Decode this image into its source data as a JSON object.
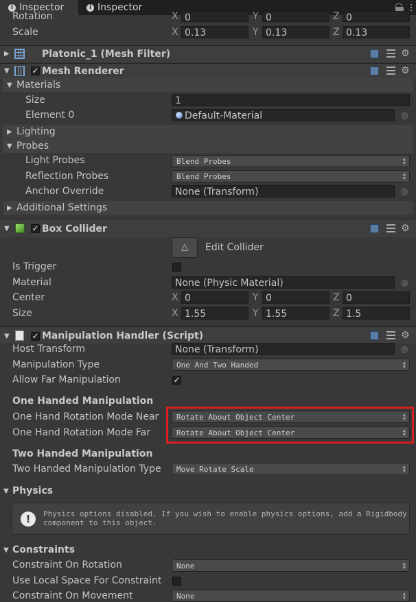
{
  "tabs": [
    {
      "label": "Inspector",
      "icon": "info-icon"
    },
    {
      "label": "Inspector",
      "icon": "info-icon"
    }
  ],
  "transform": {
    "rotation_label": "Rotation",
    "rotation": {
      "x": "0",
      "y": "0",
      "z": "0"
    },
    "scale_label": "Scale",
    "scale": {
      "x": "0.13",
      "y": "0.13",
      "z": "0.13"
    },
    "axis_labels": {
      "x": "X",
      "y": "Y",
      "z": "Z"
    }
  },
  "mesh_filter": {
    "title": "Platonic_1 (Mesh Filter)"
  },
  "mesh_renderer": {
    "title": "Mesh Renderer",
    "enabled": true,
    "materials_label": "Materials",
    "size_label": "Size",
    "size_value": "1",
    "element0_label": "Element 0",
    "element0_value": "Default-Material",
    "lighting_label": "Lighting",
    "probes_label": "Probes",
    "light_probes_label": "Light Probes",
    "light_probes_value": "Blend Probes",
    "reflection_probes_label": "Reflection Probes",
    "reflection_probes_value": "Blend Probes",
    "anchor_override_label": "Anchor Override",
    "anchor_override_value": "None (Transform)",
    "additional_settings_label": "Additional Settings"
  },
  "box_collider": {
    "title": "Box Collider",
    "enabled": true,
    "edit_collider_label": "Edit Collider",
    "is_trigger_label": "Is Trigger",
    "is_trigger": false,
    "material_label": "Material",
    "material_value": "None (Physic Material)",
    "center_label": "Center",
    "center": {
      "x": "0",
      "y": "0",
      "z": "0"
    },
    "size_label": "Size",
    "size": {
      "x": "1.55",
      "y": "1.55",
      "z": "1.5"
    }
  },
  "manipulation_handler": {
    "title": "Manipulation Handler (Script)",
    "enabled": true,
    "host_transform_label": "Host Transform",
    "host_transform_value": "None (Transform)",
    "manipulation_type_label": "Manipulation Type",
    "manipulation_type_value": "One And Two Handed",
    "allow_far_label": "Allow Far Manipulation",
    "allow_far": true,
    "one_handed_header": "One Handed Manipulation",
    "rot_near_label": "One Hand Rotation Mode Near",
    "rot_near_value": "Rotate About Object Center",
    "rot_far_label": "One Hand Rotation Mode Far",
    "rot_far_value": "Rotate About Object Center",
    "two_handed_header": "Two Handed Manipulation",
    "two_handed_type_label": "Two Handed Manipulation Type",
    "two_handed_type_value": "Move Rotate Scale",
    "physics_header": "Physics",
    "physics_help": "Physics options disabled. If you wish to enable physics options, add a Rigidbody component to this object.",
    "constraints_header": "Constraints",
    "constraint_rotation_label": "Constraint On Rotation",
    "constraint_rotation_value": "None",
    "local_space_label": "Use Local Space For Constraint",
    "local_space": false,
    "constraint_movement_label": "Constraint On Movement",
    "constraint_movement_value": "None"
  },
  "colors": {
    "highlight": "#d91f1f",
    "panel": "#383838",
    "field": "#262626"
  }
}
